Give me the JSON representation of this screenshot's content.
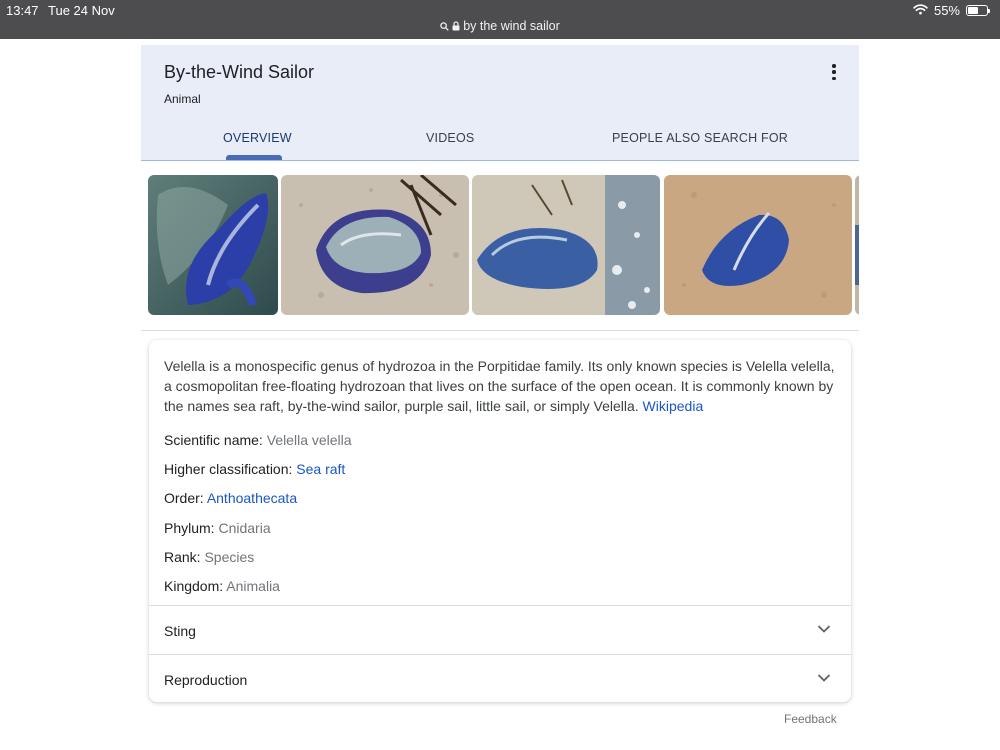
{
  "status_bar": {
    "time": "13:47",
    "date": "Tue 24 Nov",
    "url": "by the wind sailor",
    "battery": "55%",
    "battery_level": 0.55
  },
  "header": {
    "title": "By-the-Wind Sailor",
    "subtitle": "Animal",
    "tabs": [
      {
        "label": "OVERVIEW",
        "active": true
      },
      {
        "label": "VIDEOS",
        "active": false
      },
      {
        "label": "PEOPLE ALSO SEARCH FOR",
        "active": false
      }
    ]
  },
  "images": [
    {
      "name": "velella-photo-1"
    },
    {
      "name": "velella-photo-2"
    },
    {
      "name": "velella-photo-3"
    },
    {
      "name": "velella-photo-4"
    },
    {
      "name": "velella-photo-5"
    }
  ],
  "description": {
    "text": "Velella is a monospecific genus of hydrozoa in the Porpitidae family. Its only known species is Velella velella, a cosmopolitan free-floating hydrozoan that lives on the surface of the open ocean. It is commonly known by the names sea raft, by-the-wind sailor, purple sail, little sail, or simply Velella.",
    "source_link": "Wikipedia"
  },
  "facts": [
    {
      "label": "Scientific name:",
      "value": "Velella velella",
      "is_link": false
    },
    {
      "label": "Higher classification:",
      "value": "Sea raft",
      "is_link": true
    },
    {
      "label": "Order:",
      "value": "Anthoathecata",
      "is_link": true
    },
    {
      "label": "Phylum:",
      "value": "Cnidaria",
      "is_link": false
    },
    {
      "label": "Rank:",
      "value": "Species",
      "is_link": false
    },
    {
      "label": "Kingdom:",
      "value": "Animalia",
      "is_link": false
    }
  ],
  "accordions": [
    {
      "label": "Sting"
    },
    {
      "label": "Reproduction"
    }
  ],
  "footer": {
    "feedback": "Feedback"
  },
  "colors": {
    "header_bg": "#e8edf8",
    "link": "#1a56c4",
    "tab_indicator": "#4a6bb8",
    "status_bar": "#4d4d4f"
  }
}
